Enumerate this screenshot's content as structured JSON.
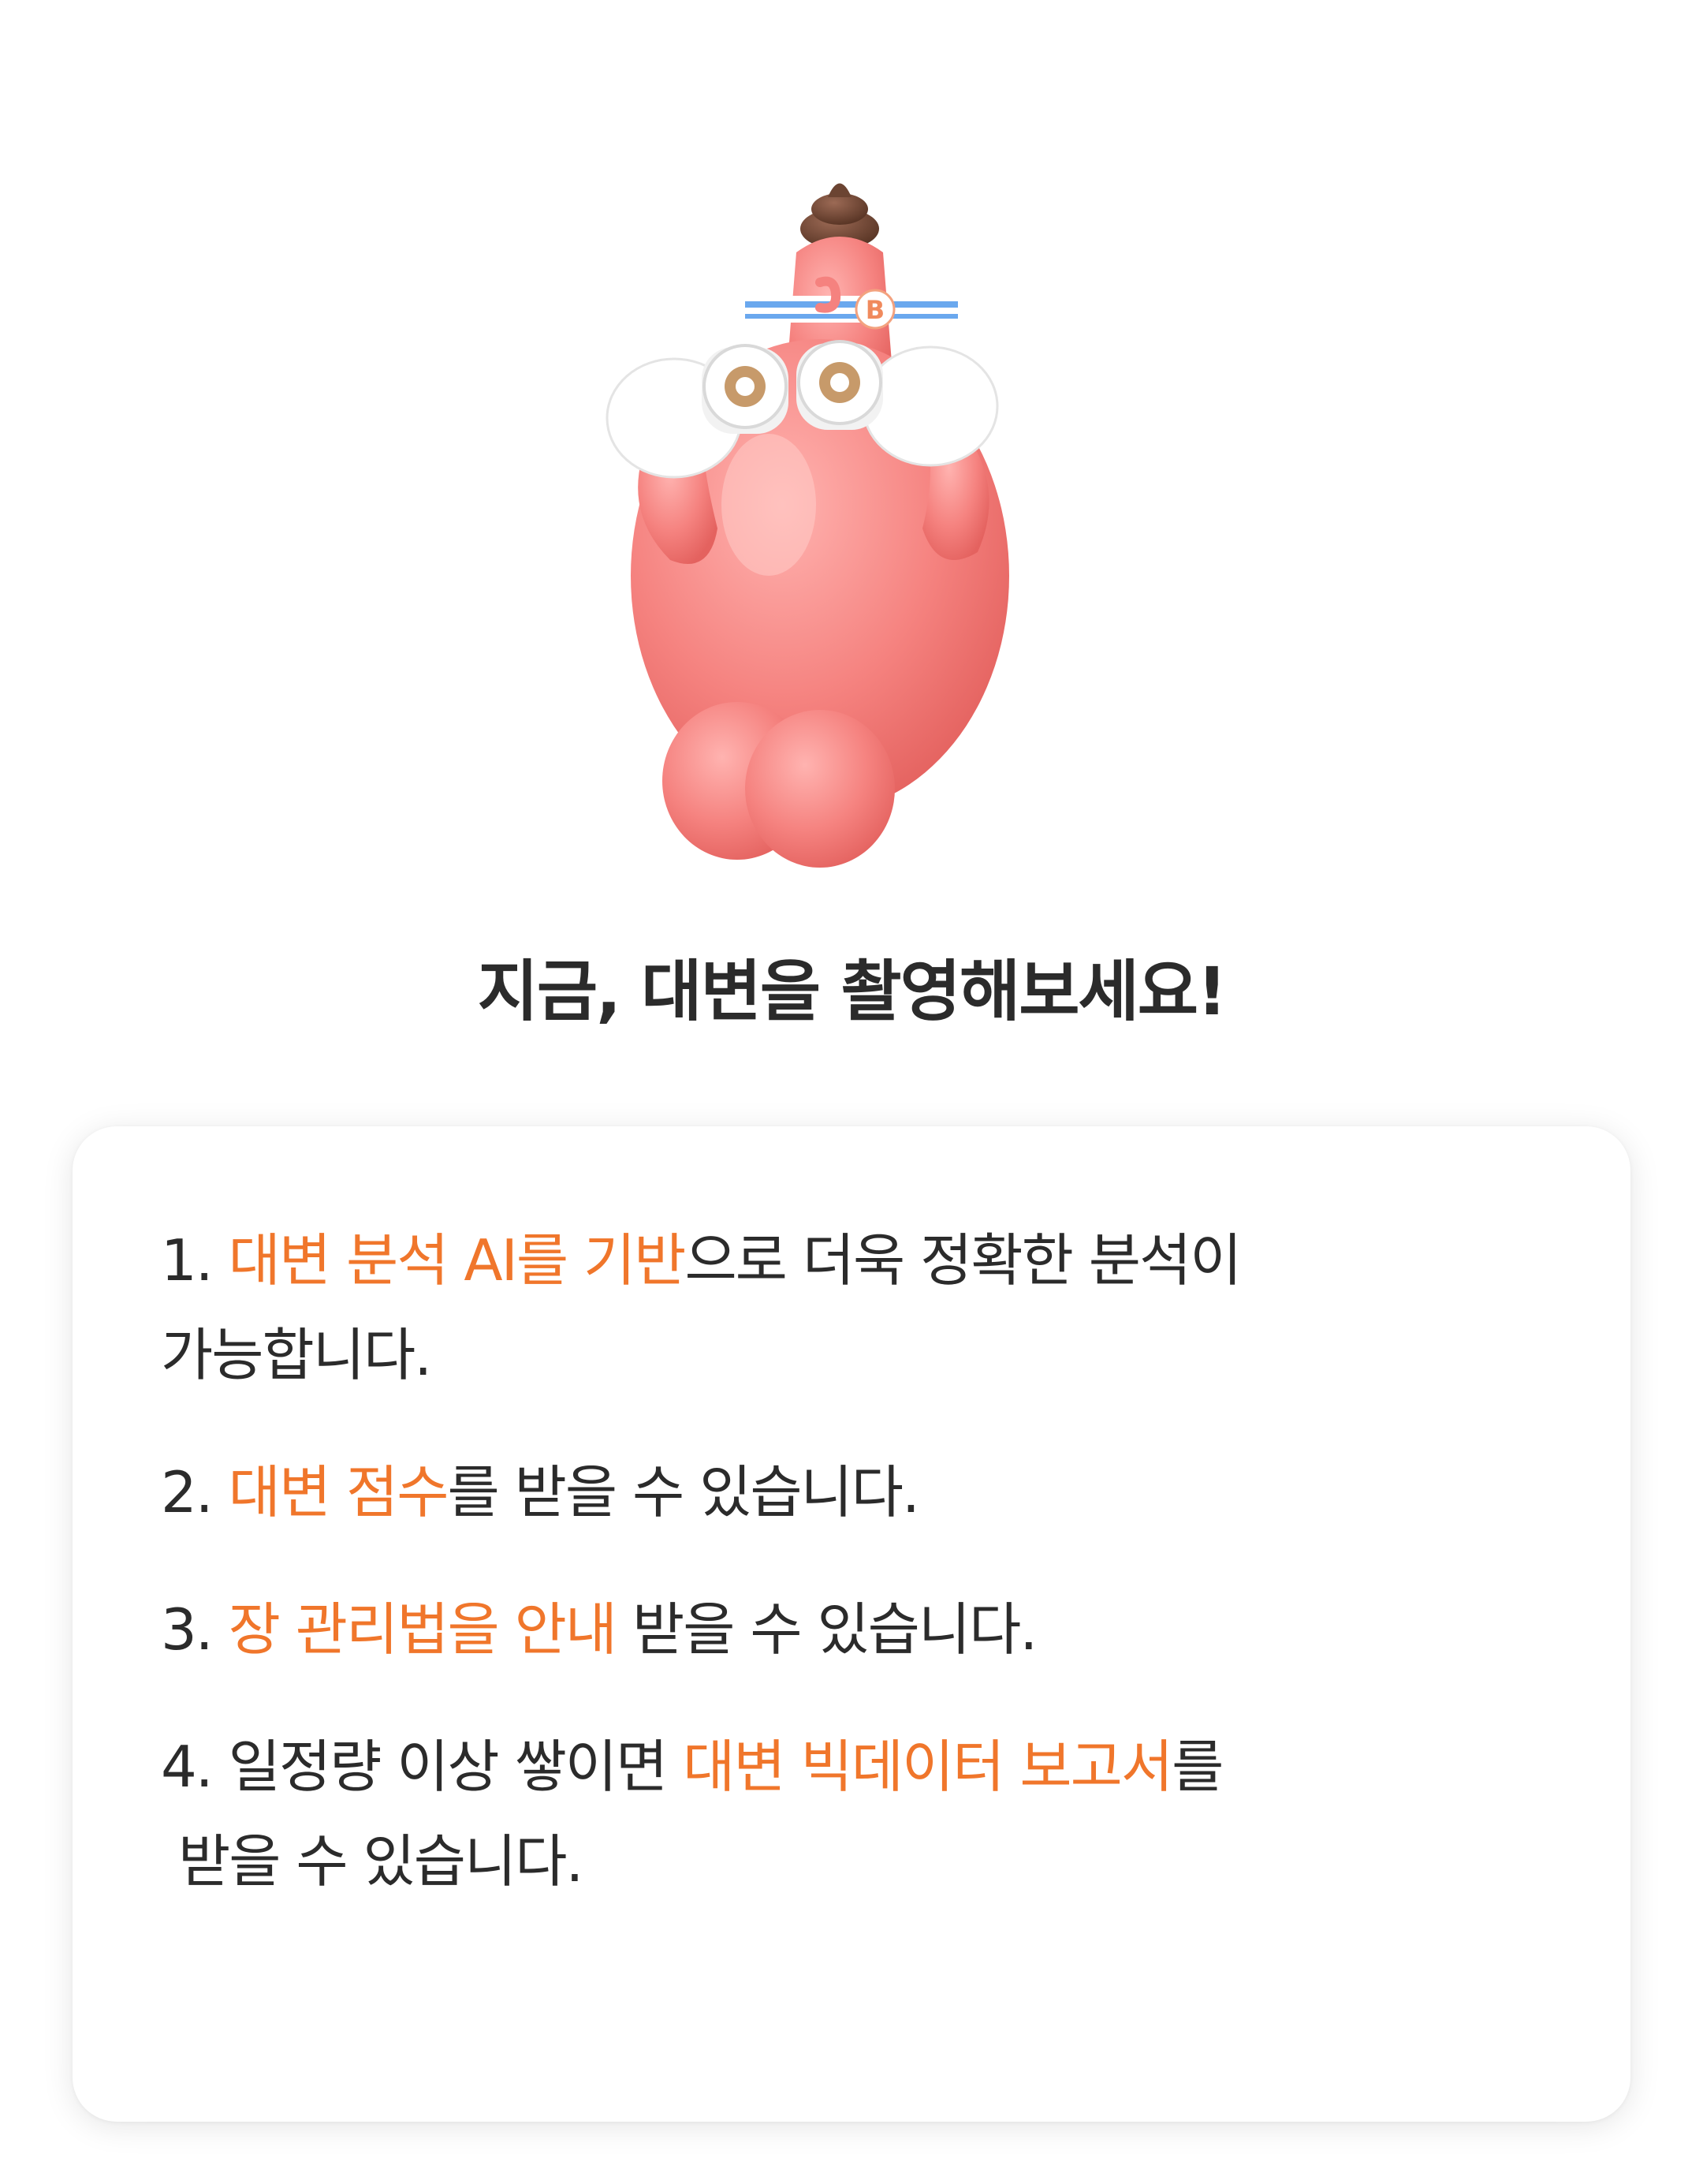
{
  "mascot": {
    "name": "binoculars-mascot",
    "badge_letter": "B",
    "accent": "#f58a8a"
  },
  "headline": "지금, 대변을 촬영해보세요!",
  "colors": {
    "highlight": "#f0762b",
    "text": "#2b2b2b"
  },
  "items": [
    {
      "num": "1.",
      "hl": "대변 분석 AI를 기반",
      "rest": "으로 더욱 정확한 분석이",
      "cont": "가능합니다."
    },
    {
      "num": "2.",
      "hl": "대변 점수",
      "rest": "를 받을 수 있습니다."
    },
    {
      "num": "3.",
      "hl": "장 관리법을 안내",
      "rest": " 받을 수 있습니다."
    },
    {
      "num": "4.",
      "pre": " 일정량 이상 쌓이면 ",
      "hl": "대변 빅데이터 보고서",
      "rest": "를",
      "cont": "받을 수 있습니다."
    }
  ]
}
